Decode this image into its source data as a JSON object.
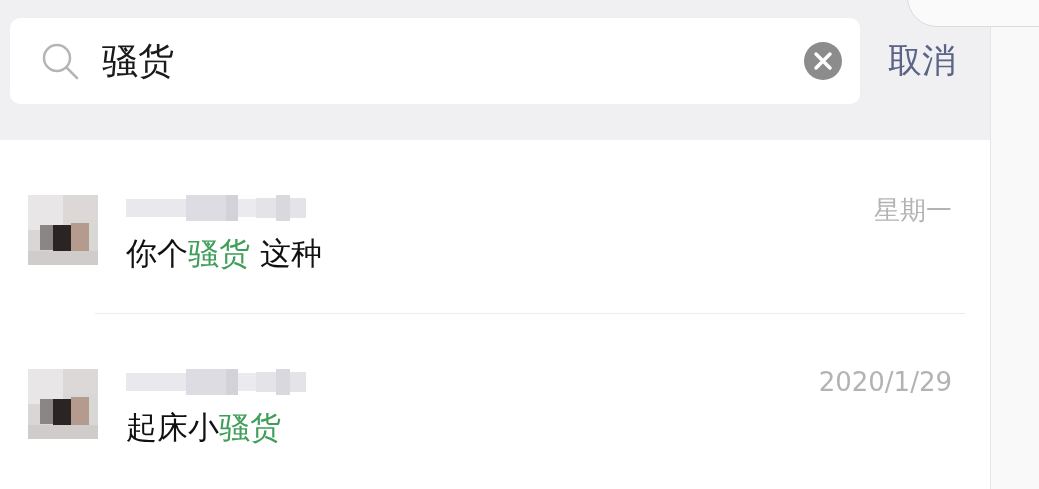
{
  "search": {
    "value": "骚货",
    "cancel": "取消"
  },
  "results": [
    {
      "kind": "picture",
      "time": "星期一",
      "message": [
        {
          "text": "你个",
          "highlighted": false
        },
        {
          "text": "骚货",
          "highlighted": true
        },
        {
          "text": " 这种",
          "highlighted": false
        }
      ]
    },
    {
      "kind": "picture",
      "time": "2020/1/29",
      "message": [
        {
          "text": "起床小",
          "highlighted": false
        },
        {
          "text": "骚货",
          "highlighted": true
        }
      ]
    }
  ]
}
